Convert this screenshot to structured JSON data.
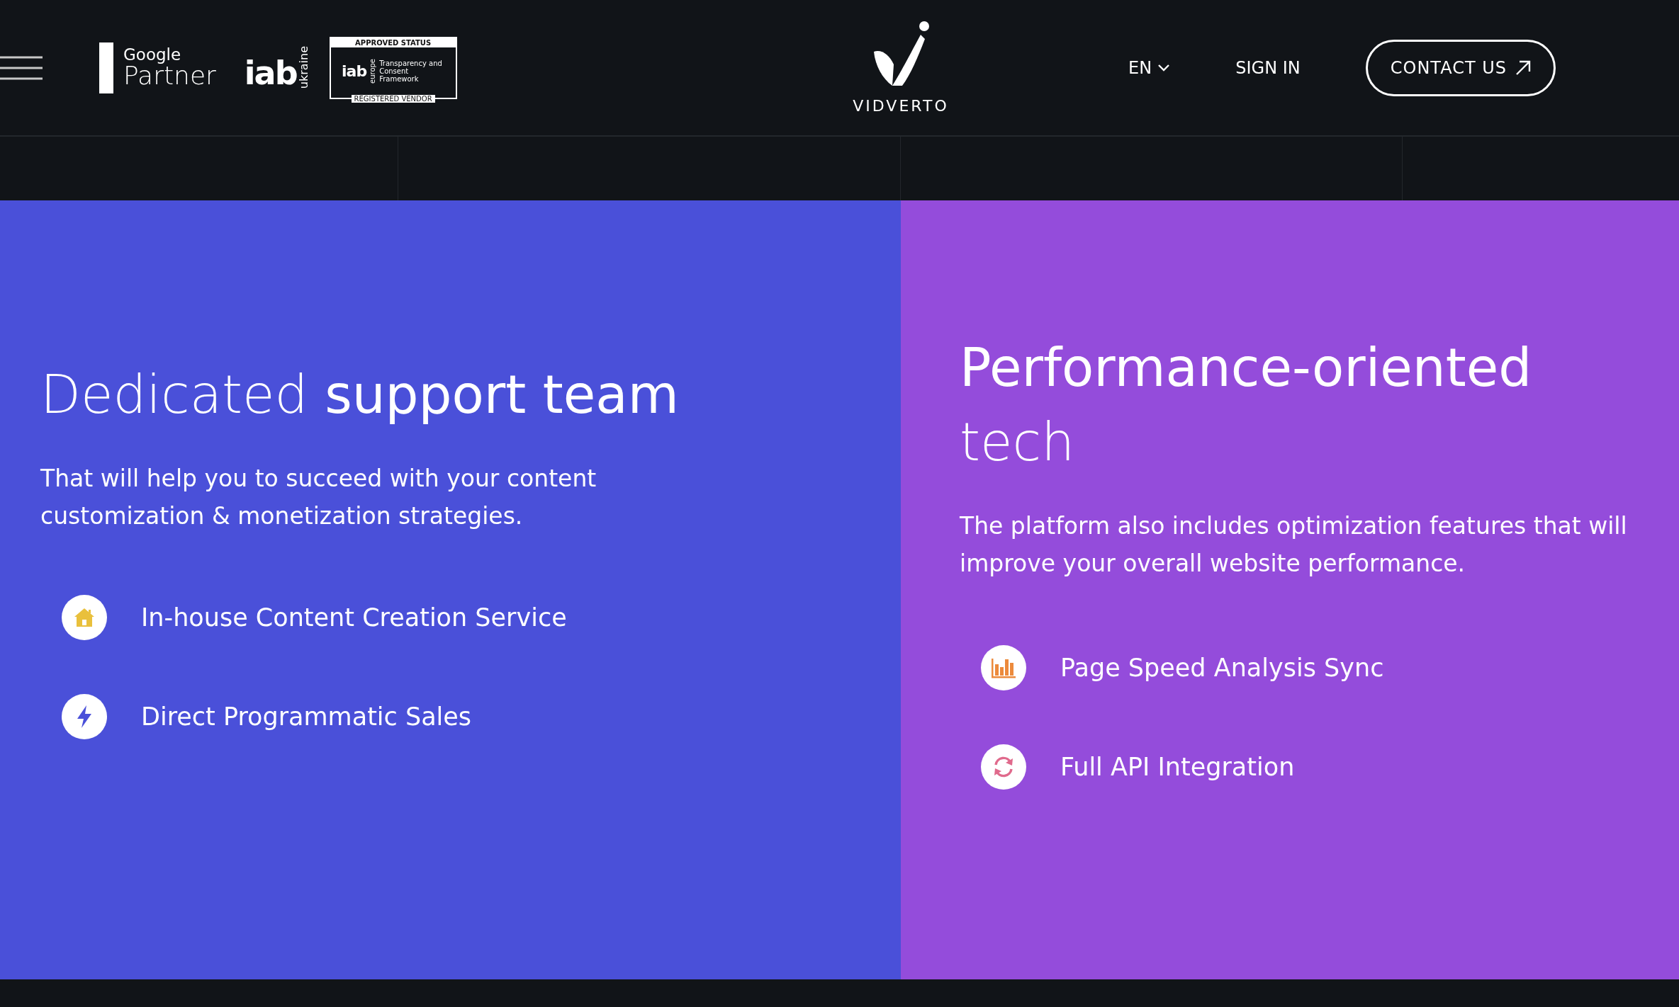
{
  "header": {
    "badges": {
      "google": {
        "brand": "Google",
        "label": "Partner"
      },
      "iab_ukraine": {
        "brand": "iab",
        "suffix": "ukraine"
      },
      "tcf": {
        "top": "APPROVED STATUS",
        "brand": "iab",
        "region": "europe",
        "text": "Transparency and Consent Framework",
        "bottom": "REGISTERED VENDOR"
      }
    },
    "logo": {
      "name": "VIDVERTO"
    },
    "nav": {
      "language": "EN",
      "sign_in": "SIGN IN",
      "contact": "CONTACT US"
    }
  },
  "panels": [
    {
      "title": "Dedicated **support team**",
      "text": "That will help you to succeed with your content customization & monetization strategies.",
      "items": [
        {
          "kind": "home",
          "color": "#e9c03c",
          "label": "In-house Content Creation Service"
        },
        {
          "kind": "bolt",
          "color": "#4a50d9",
          "label": "Direct Programmatic Sales"
        }
      ]
    },
    {
      "title": "**Performance-oriented** tech",
      "text": "The platform also includes optimization features that will improve your overall website performance.",
      "items": [
        {
          "kind": "chart",
          "color": "#ec8a3c",
          "label": "Page Speed Analysis Sync"
        },
        {
          "kind": "sync",
          "color": "#e06a8c",
          "label": "Full API Integration"
        }
      ]
    }
  ]
}
